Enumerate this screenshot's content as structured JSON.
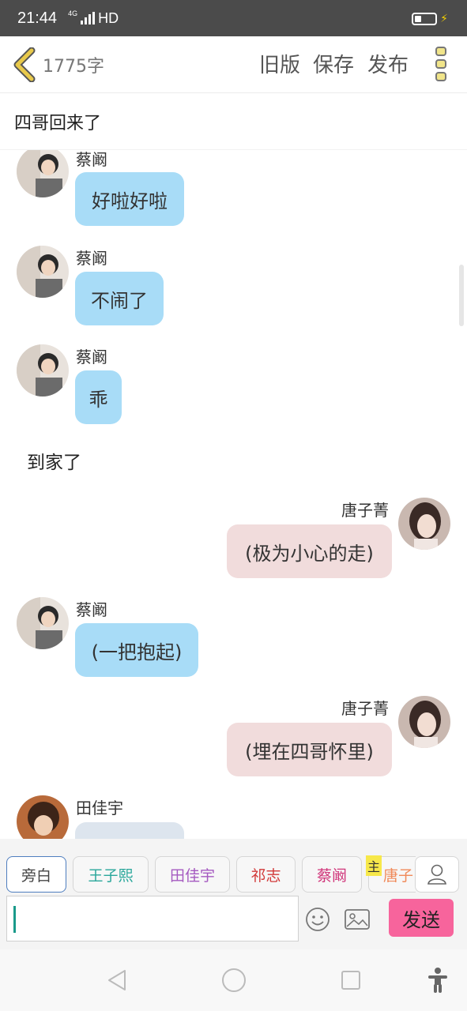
{
  "status_bar": {
    "time": "21:44",
    "network": "HD",
    "signal_label": "4G"
  },
  "header": {
    "word_count": "1775字",
    "actions": {
      "old_version": "旧版",
      "save": "保存",
      "publish": "发布"
    }
  },
  "chapter": {
    "title": "四哥回来了"
  },
  "messages": [
    {
      "name": "蔡阚",
      "text": "好啦好啦"
    },
    {
      "name": "蔡阚",
      "text": "不闹了"
    },
    {
      "name": "蔡阚",
      "text": "乖"
    },
    {
      "narration": "到家了"
    },
    {
      "name": "唐子菁",
      "text": "(极为小心的走)"
    },
    {
      "name": "蔡阚",
      "text": "(一把抱起)"
    },
    {
      "name": "唐子菁",
      "text": "(埋在四哥怀里)"
    },
    {
      "name": "田佳宇",
      "text": ""
    }
  ],
  "characters": [
    {
      "label": "旁白",
      "color": "#444444"
    },
    {
      "label": "王子熙",
      "color": "#2aa79b"
    },
    {
      "label": "田佳宇",
      "color": "#a55ac0"
    },
    {
      "label": "祁志",
      "color": "#d23a3a"
    },
    {
      "label": "蔡阚",
      "color": "#d0357a"
    },
    {
      "label": "唐子",
      "color": "#f08a5a"
    }
  ],
  "host_badge": "主",
  "composer": {
    "send_label": "发送",
    "input_value": ""
  },
  "colors": {
    "left_bubble": "#a8dcf7",
    "right_bubble": "#f1dcdc",
    "send_button": "#f7649c",
    "back_icon": "#e8c94b"
  }
}
